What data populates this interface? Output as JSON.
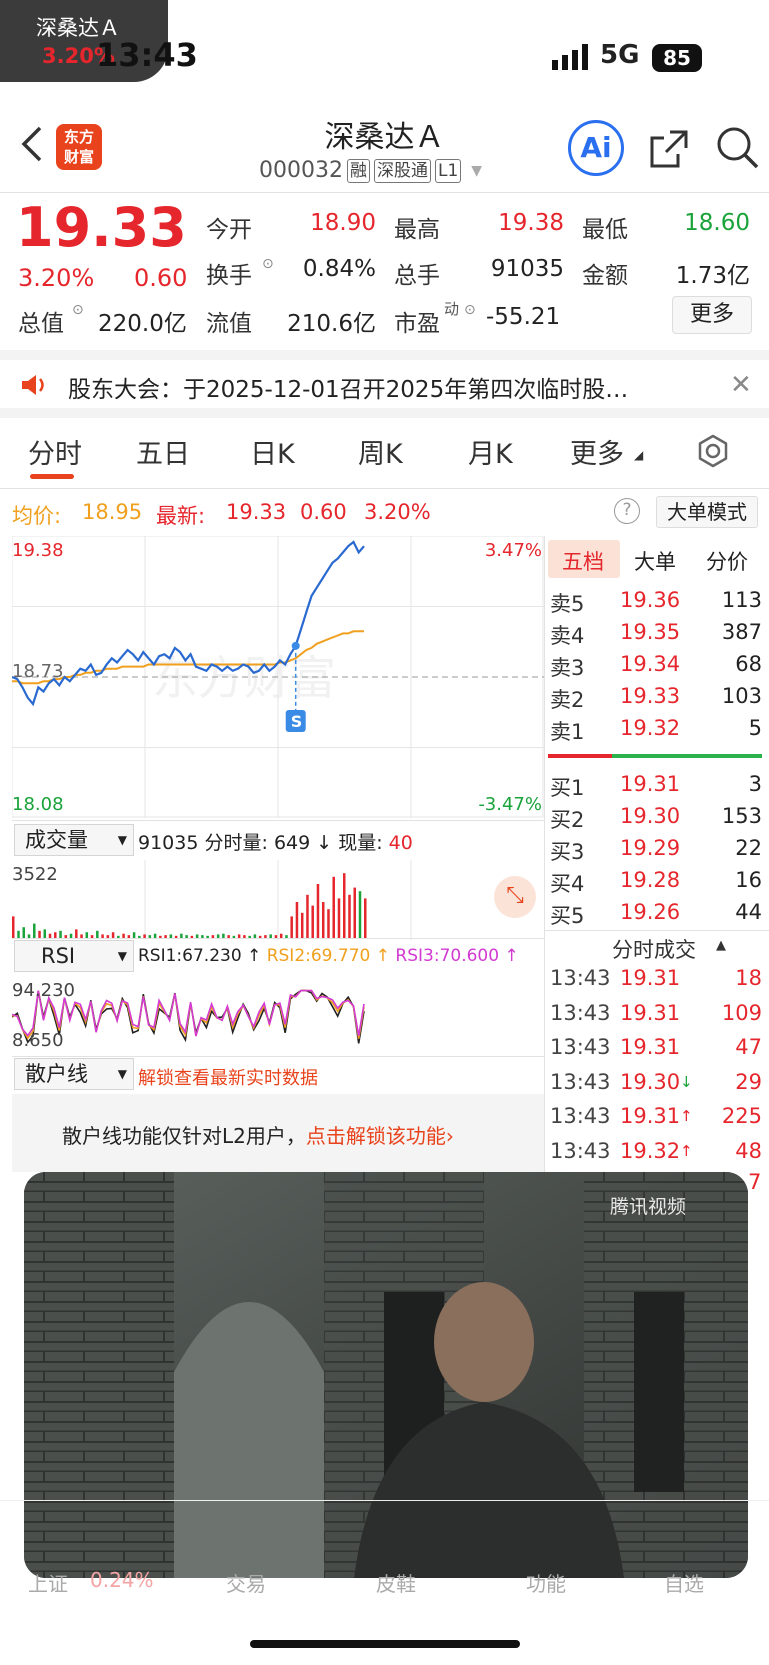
{
  "status_bar": {
    "pip_name": "深桑达Ａ",
    "pip_pct": "3.20%",
    "time": "13:43",
    "network": "5G",
    "battery": "85"
  },
  "header": {
    "logo_line1": "东方",
    "logo_line2": "财富",
    "title": "深桑达Ａ",
    "code": "000032",
    "tags": [
      "融",
      "深股通",
      "L1"
    ],
    "ai_label": "Ai"
  },
  "quote": {
    "price": "19.33",
    "change_pct": "3.20%",
    "change": "0.60",
    "stats": [
      {
        "label": "今开",
        "value": "18.90",
        "color": "red"
      },
      {
        "label": "最高",
        "value": "19.38",
        "color": "red"
      },
      {
        "label": "最低",
        "value": "18.60",
        "color": "green"
      },
      {
        "label": "换手",
        "value": "0.84%",
        "color": "dark"
      },
      {
        "label": "总手",
        "value": "91035",
        "color": "dark"
      },
      {
        "label": "金额",
        "value": "1.73亿",
        "color": "dark"
      }
    ],
    "total_value_label": "总值",
    "total_value": "220.0亿",
    "float_value_label": "流值",
    "float_value": "210.6亿",
    "pe_label": "市盈",
    "pe_sup": "动",
    "pe_value": "-55.21",
    "more_button": "更多"
  },
  "notice": {
    "text": "股东大会：于2025-12-01召开2025年第四次临时股…"
  },
  "tabs": [
    "分时",
    "五日",
    "日K",
    "周K",
    "月K",
    "更多"
  ],
  "chart_header": {
    "avg_label": "均价:",
    "avg_value": "18.95",
    "latest_label": "最新:",
    "latest_value": "19.33",
    "latest_change": "0.60",
    "latest_pct": "3.20%",
    "mode_button": "大单模式"
  },
  "chart_data": {
    "type": "line",
    "y_top_label": "19.38",
    "y_bottom_label": "18.08",
    "y_mid_label": "18.73",
    "pct_top_label": "3.47%",
    "pct_bottom_label": "-3.47%",
    "ylim": [
      18.08,
      19.38
    ],
    "baseline": 18.73,
    "watermark": "东方财富",
    "signal_marker": "S",
    "series": [
      {
        "name": "price",
        "values": [
          18.73,
          18.72,
          18.68,
          18.63,
          18.6,
          18.68,
          18.66,
          18.7,
          18.72,
          18.69,
          18.73,
          18.71,
          18.74,
          18.77,
          18.76,
          18.79,
          18.74,
          18.75,
          18.79,
          18.82,
          18.8,
          18.83,
          18.86,
          18.84,
          18.81,
          18.85,
          18.82,
          18.79,
          18.83,
          18.84,
          18.82,
          18.87,
          18.85,
          18.81,
          18.84,
          18.78,
          18.77,
          18.76,
          18.79,
          18.78,
          18.76,
          18.78,
          18.76,
          18.77,
          18.79,
          18.78,
          18.75,
          18.76,
          18.79,
          18.76,
          18.78,
          18.81,
          18.79,
          18.84,
          18.88,
          18.96,
          19.04,
          19.12,
          19.16,
          19.2,
          19.24,
          19.28,
          19.3,
          19.33,
          19.36,
          19.38,
          19.33,
          19.36
        ]
      },
      {
        "name": "avg",
        "values": [
          18.71,
          18.71,
          18.7,
          18.7,
          18.7,
          18.7,
          18.71,
          18.71,
          18.72,
          18.72,
          18.73,
          18.73,
          18.74,
          18.74,
          18.75,
          18.75,
          18.76,
          18.76,
          18.77,
          18.77,
          18.77,
          18.78,
          18.78,
          18.78,
          18.78,
          18.78,
          18.79,
          18.79,
          18.79,
          18.79,
          18.79,
          18.79,
          18.79,
          18.79,
          18.79,
          18.79,
          18.79,
          18.79,
          18.79,
          18.79,
          18.79,
          18.79,
          18.79,
          18.79,
          18.79,
          18.79,
          18.79,
          18.79,
          18.79,
          18.79,
          18.79,
          18.8,
          18.8,
          18.81,
          18.82,
          18.84,
          18.86,
          18.87,
          18.89,
          18.9,
          18.91,
          18.92,
          18.93,
          18.94,
          18.94,
          18.95,
          18.95,
          18.95
        ]
      }
    ]
  },
  "volume_panel": {
    "selector": "成交量",
    "total": "91035",
    "minute_label": "分时量:",
    "minute_value": "649",
    "current_label": "现量:",
    "current_value": "40",
    "top_label": "3522",
    "bars": [
      0.3,
      0.1,
      0.15,
      0.05,
      0.2,
      0.1,
      0.12,
      0.06,
      0.08,
      0.1,
      0.04,
      0.06,
      0.12,
      0.05,
      0.08,
      0.04,
      0.1,
      0.05,
      0.04,
      0.08,
      0.03,
      0.06,
      0.04,
      0.08,
      0.03,
      0.05,
      0.04,
      0.06,
      0.03,
      0.04,
      0.05,
      0.03,
      0.06,
      0.04,
      0.03,
      0.05,
      0.04,
      0.03,
      0.04,
      0.05,
      0.06,
      0.04,
      0.03,
      0.05,
      0.04,
      0.03,
      0.05,
      0.03,
      0.04,
      0.05,
      0.04,
      0.06,
      0.04,
      0.3,
      0.5,
      0.35,
      0.6,
      0.45,
      0.75,
      0.5,
      0.4,
      0.85,
      0.55,
      0.9,
      0.6,
      0.7,
      0.65,
      0.55
    ]
  },
  "rsi_panel": {
    "selector": "RSI",
    "rsi1": "RSI1:67.230 ↑",
    "rsi2": "RSI2:69.770 ↑",
    "rsi3": "RSI3:70.600 ↑",
    "top_label": "94.230",
    "bottom_label": "8.650"
  },
  "retail_panel": {
    "selector": "散户线",
    "unlock_text": "解锁查看最新实时数据",
    "message": "散户线功能仅针对L2用户，",
    "message_link": "点击解锁该功能›"
  },
  "orderbook": {
    "tabs": [
      "五档",
      "大单",
      "分价"
    ],
    "asks": [
      {
        "label": "卖5",
        "price": "19.36",
        "volume": "113"
      },
      {
        "label": "卖4",
        "price": "19.35",
        "volume": "387"
      },
      {
        "label": "卖3",
        "price": "19.34",
        "volume": "68"
      },
      {
        "label": "卖2",
        "price": "19.33",
        "volume": "103"
      },
      {
        "label": "卖1",
        "price": "19.32",
        "volume": "5"
      }
    ],
    "bids": [
      {
        "label": "买1",
        "price": "19.31",
        "volume": "3"
      },
      {
        "label": "买2",
        "price": "19.30",
        "volume": "153"
      },
      {
        "label": "买3",
        "price": "19.29",
        "volume": "22"
      },
      {
        "label": "买4",
        "price": "19.28",
        "volume": "16"
      },
      {
        "label": "买5",
        "price": "19.26",
        "volume": "44"
      }
    ]
  },
  "trades": {
    "title": "分时成交",
    "rows": [
      {
        "time": "13:43",
        "price": "19.31",
        "arrow": "",
        "volume": "18"
      },
      {
        "time": "13:43",
        "price": "19.31",
        "arrow": "",
        "volume": "109"
      },
      {
        "time": "13:43",
        "price": "19.31",
        "arrow": "",
        "volume": "47"
      },
      {
        "time": "13:43",
        "price": "19.30",
        "arrow": "↓",
        "volume": "29"
      },
      {
        "time": "13:43",
        "price": "19.31",
        "arrow": "↑",
        "volume": "225"
      },
      {
        "time": "13:43",
        "price": "19.32",
        "arrow": "↑",
        "volume": "48"
      }
    ]
  },
  "video_overlay": {
    "watermark": "腾讯视频"
  },
  "bottom_nav": {
    "items": [
      "上证",
      "0.24%",
      "交易",
      "皮鞋",
      "功能",
      "自选"
    ]
  }
}
